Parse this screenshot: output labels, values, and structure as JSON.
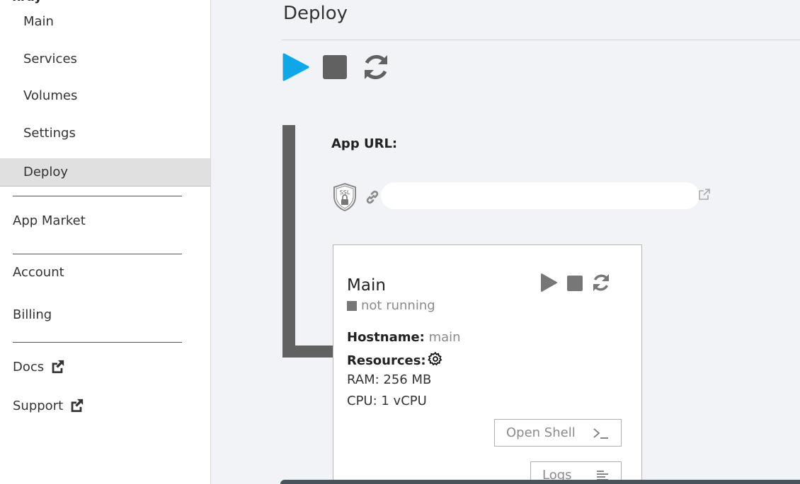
{
  "sidebar": {
    "app_name": "xray",
    "items": [
      {
        "label": "Main"
      },
      {
        "label": "Services"
      },
      {
        "label": "Volumes"
      },
      {
        "label": "Settings"
      },
      {
        "label": "Deploy",
        "active": true
      }
    ],
    "app_market": "App Market",
    "account": "Account",
    "billing": "Billing",
    "docs": "Docs",
    "support": "Support"
  },
  "main": {
    "title": "Deploy",
    "app_url_label": "App URL:",
    "ssl_text": "SSL",
    "service": {
      "name": "Main",
      "status": "not running",
      "hostname_label": "Hostname:",
      "hostname_value": "main",
      "resources_label": "Resources:",
      "ram": "RAM: 256 MB",
      "cpu": "CPU: 1 vCPU",
      "open_shell": "Open Shell",
      "logs": "Logs"
    }
  },
  "colors": {
    "accent_play": "#10a7e8",
    "icon_gray": "#616161",
    "active_nav_bg": "#e0e0e0"
  },
  "icons": [
    "play-icon",
    "stop-icon",
    "restart-icon",
    "ssl-shield-icon",
    "link-icon",
    "external-link-icon",
    "gear-icon",
    "terminal-icon",
    "logs-icon"
  ]
}
